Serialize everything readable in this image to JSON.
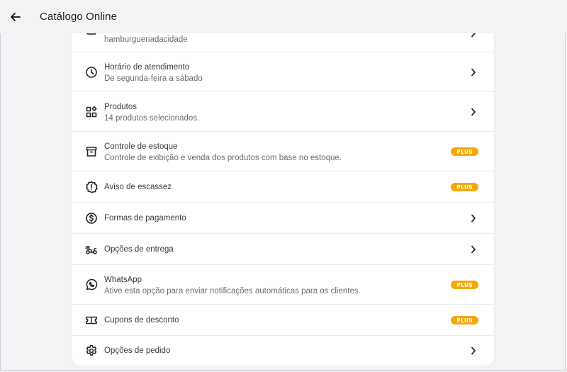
{
  "header": {
    "title": "Catálogo Online"
  },
  "colors": {
    "badge": "#f5a70a",
    "background": "#f3f3f5",
    "card": "#ffffff"
  },
  "rows": [
    {
      "icon": "storefront-icon",
      "label": "",
      "sub": "hamburgueriadacidade",
      "action": "chevron"
    },
    {
      "icon": "clock-icon",
      "label": "Horário de atendimento",
      "sub": "De segunda-feira a sábado",
      "action": "chevron"
    },
    {
      "icon": "grid-icon",
      "label": "Produtos",
      "sub": "14 produtos selecionados.",
      "action": "chevron"
    },
    {
      "icon": "archive-box-icon",
      "label": "Controle de estoque",
      "sub": "Controle de exibição e venda dos produtos com base no estoque.",
      "action": "badge",
      "badge": "PLUS"
    },
    {
      "icon": "alert-badge-icon",
      "label": "Aviso de escassez",
      "action": "badge",
      "badge": "PLUS"
    },
    {
      "icon": "dollar-circle-icon",
      "label": "Formas de pagamento",
      "action": "chevron"
    },
    {
      "icon": "scooter-icon",
      "label": "Opções de entrega",
      "action": "chevron"
    },
    {
      "icon": "whatsapp-icon",
      "label": "WhatsApp",
      "sub": "Ative esta opção para enviar notificações automáticas para os clientes.",
      "action": "badge",
      "badge": "PLUS"
    },
    {
      "icon": "ticket-icon",
      "label": "Cupons de desconto",
      "action": "badge",
      "badge": "PLUS"
    },
    {
      "icon": "gear-icon",
      "label": "Opções de pedido",
      "action": "chevron"
    }
  ]
}
